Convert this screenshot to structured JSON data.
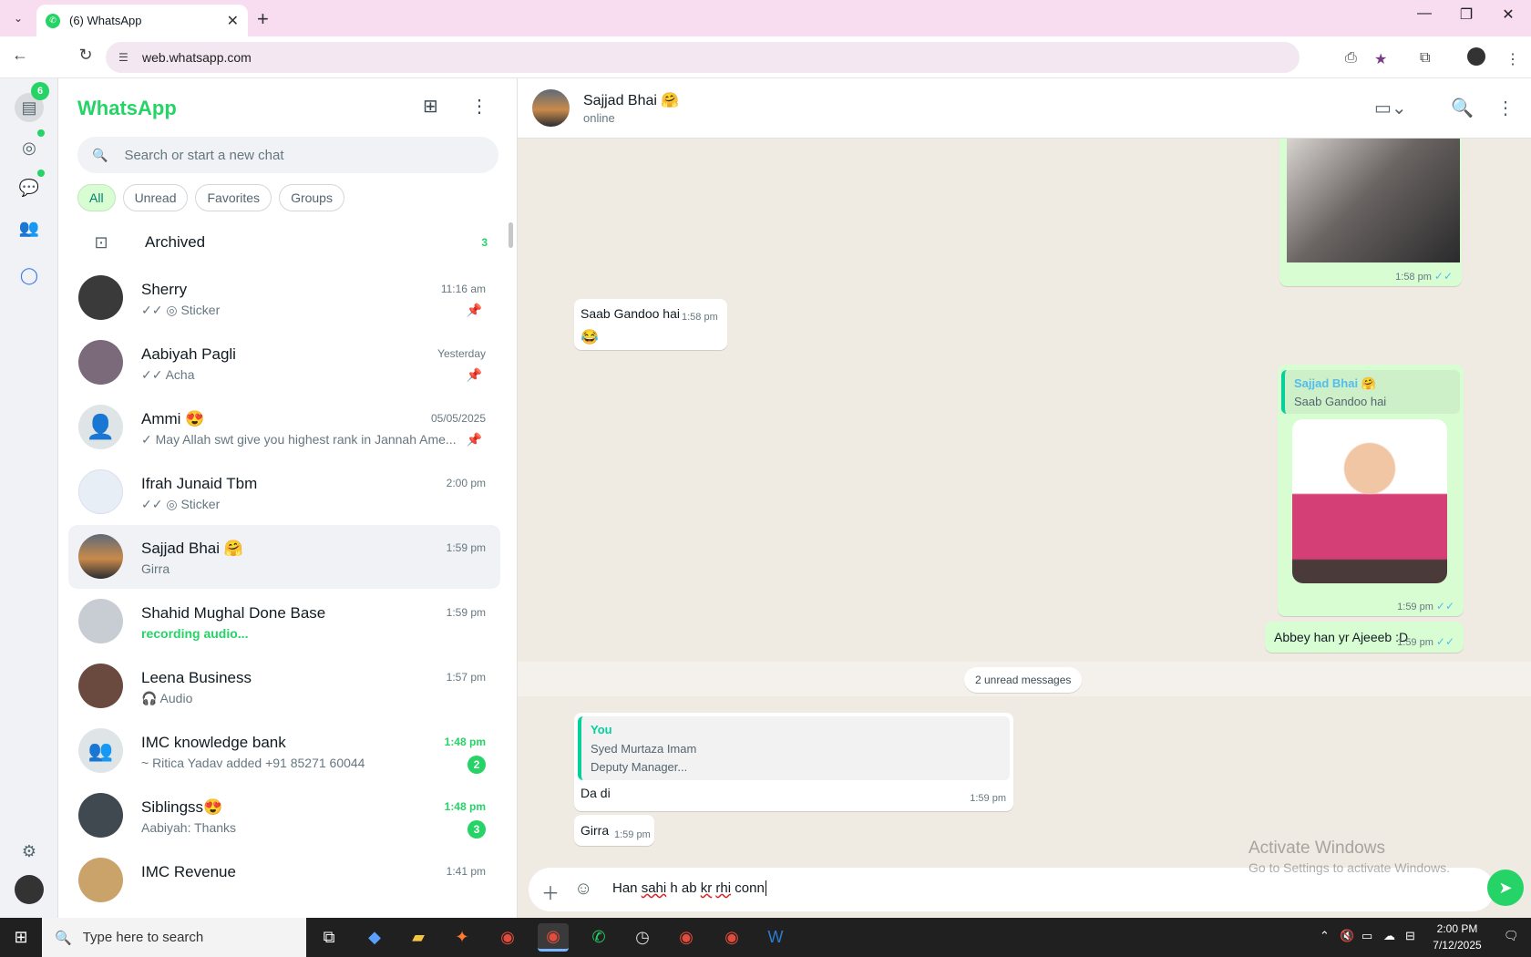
{
  "browser": {
    "tab_title": "(6) WhatsApp",
    "url": "web.whatsapp.com"
  },
  "rail": {
    "chats_badge": "6"
  },
  "list": {
    "brand": "WhatsApp",
    "search_placeholder": "Search or start a new chat",
    "filters": [
      "All",
      "Unread",
      "Favorites",
      "Groups"
    ],
    "archived_label": "Archived",
    "archived_count": "3",
    "chats": [
      {
        "name": "Sherry",
        "time": "11:16 am",
        "preview": "✓✓ ◎ Sticker",
        "pinned": true
      },
      {
        "name": "Aabiyah Pagli",
        "time": "Yesterday",
        "preview": "✓✓ Acha",
        "pinned": true
      },
      {
        "name": "Ammi 😍",
        "time": "05/05/2025",
        "preview": "✓ May Allah swt give you highest rank in Jannah  Ame...",
        "pinned": true
      },
      {
        "name": "Ifrah Junaid Tbm",
        "time": "2:00 pm",
        "preview": "✓✓ ◎ Sticker"
      },
      {
        "name": "Sajjad Bhai 🤗",
        "time": "1:59 pm",
        "preview": "Girra"
      },
      {
        "name": "Shahid Mughal Done Base",
        "time": "1:59 pm",
        "preview": "recording audio..."
      },
      {
        "name": "Leena Business",
        "time": "1:57 pm",
        "preview": "🎧 Audio"
      },
      {
        "name": "IMC knowledge bank",
        "time": "1:48 pm",
        "preview": "~ Ritica Yadav added +91 85271 60044",
        "unread": "2"
      },
      {
        "name": "Siblingss😍",
        "time": "1:48 pm",
        "preview": "Aabiyah: Thanks",
        "unread": "3"
      },
      {
        "name": "IMC Revenue",
        "time": "1:41 pm",
        "preview": ""
      }
    ]
  },
  "conversation": {
    "name": "Sajjad Bhai 🤗",
    "status": "online",
    "messages": {
      "m1_time": "1:58 pm",
      "m2_text": "Saab Gandoo hai",
      "m2_time": "1:58 pm",
      "m2_emoji": "😂",
      "m3_quote_author": "Sajjad Bhai 🤗",
      "m3_quote_text": "Saab Gandoo hai",
      "m3_time": "1:59 pm",
      "m4_text": "Abbey han yr Ajeeeb :D",
      "m4_time": "1:59 pm",
      "unread_banner": "2 unread messages",
      "m5_quote_author": "You",
      "m5_quote_line1": "Syed Murtaza Imam",
      "m5_quote_line2": "Deputy Manager...",
      "m5_text": "Da di",
      "m5_time": "1:59 pm",
      "m6_text": "Girra",
      "m6_time": "1:59 pm"
    },
    "composer_text_parts": [
      "Han ",
      "sahi",
      " h ab ",
      "kr",
      " ",
      "rhi",
      " conn"
    ]
  },
  "watermark": {
    "line1": "Activate Windows",
    "line2": "Go to Settings to activate Windows."
  },
  "taskbar": {
    "search_placeholder": "Type here to search",
    "time": "2:00 PM",
    "date": "7/12/2025"
  },
  "colors": {
    "brand_green": "#25d366",
    "outgoing_bubble": "#d9fdd3",
    "chat_bg": "#efeae2",
    "tab_strip": "#f8dcf0"
  }
}
